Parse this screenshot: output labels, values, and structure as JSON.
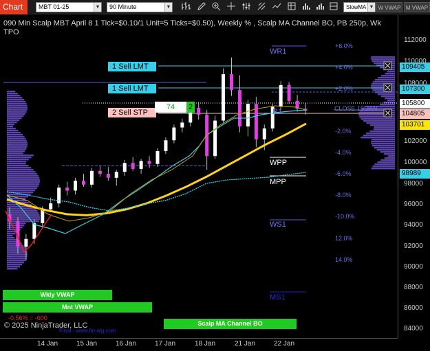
{
  "toolbar": {
    "tab_label": "Chart",
    "instrument": "MBT 01-25",
    "interval": "90 Minute",
    "strategy_select": "SlowMA",
    "btn_wvwap": "W VWAP",
    "btn_mvwap": "M VWAP"
  },
  "chart": {
    "title_line1": "090 Min Scalp MBT April 8 1 Tick=$0.10/1 Unit=5 Ticks=$0.50), Weekly % , Scalp MA Channel BO, PB 250p, Wk",
    "title_line2": "TPO",
    "levels": {
      "wr1": "WR1",
      "wpp": "WPP",
      "mpp": "MPP",
      "ws1": "WS1",
      "ms1": "MS1",
      "r1_mid": "R1",
      "close_label": "CLOSE 19 JAN"
    },
    "orders": [
      {
        "label": "1 Sell LMT"
      },
      {
        "label": "1 Sell LMT"
      },
      {
        "label": "2 Sell STP"
      }
    ],
    "stop_qty_value": "74",
    "stop_qty_marker": "2",
    "percent_labels": [
      "+6.0%",
      "+4.0%",
      "+2.0%",
      "-2.0%",
      "-4.0%",
      "-6.0%",
      "-8.0%",
      "-10.0%",
      "12.0%",
      "14.0%"
    ],
    "buttons": {
      "weekly_vwap": "Wkly VWAP",
      "monthly_vwap": "Mnt VWAP",
      "scalp_ma": "Scalp MA Channel BO"
    },
    "pnl_text": "-0.56% = -600",
    "copyright": "© 2025 NinjaTrader, LLC",
    "watermark": "Final - www.fin-alg.com"
  },
  "price_axis": {
    "labels": [
      "112000",
      "110000",
      "108000",
      "106000",
      "104000",
      "102000",
      "100000",
      "98000",
      "96000",
      "94000",
      "92000",
      "90000",
      "88000",
      "86000",
      "84000"
    ],
    "boxes": [
      {
        "value": "109405",
        "color": "#35d0e8"
      },
      {
        "value": "107300",
        "color": "#35d0e8"
      },
      {
        "value": "105800",
        "color": "#ffffff"
      },
      {
        "value": "104805",
        "color": "#ffc0c0"
      },
      {
        "value": "103701",
        "color": "#ffe600"
      },
      {
        "value": "98989",
        "color": "#35d0e8"
      }
    ]
  },
  "time_axis": {
    "labels": [
      "14 Jan",
      "15 Jan",
      "16 Jan",
      "17 Jan",
      "18 Jan",
      "21 Jan",
      "22 Jan"
    ]
  },
  "colors": {
    "tab_red": "#e23b1f",
    "cyan": "#35d0e8",
    "yellow_ma": "#ffd21a",
    "pivot_blue": "#5a5ae6",
    "green_btn": "#22c922"
  },
  "chart_data": {
    "type": "candlestick",
    "ylim": [
      83000,
      114000
    ],
    "x_labels": [
      "14 Jan",
      "15 Jan",
      "16 Jan",
      "17 Jan",
      "18 Jan",
      "21 Jan",
      "22 Jan"
    ],
    "candles": [
      [
        94500,
        95200,
        93000,
        93800
      ],
      [
        93800,
        94200,
        90500,
        91200
      ],
      [
        91200,
        92500,
        89800,
        92000
      ],
      [
        92000,
        94000,
        91500,
        93600
      ],
      [
        93600,
        95300,
        93100,
        95000
      ],
      [
        95000,
        96200,
        94700,
        95600
      ],
      [
        95600,
        97500,
        95200,
        97200
      ],
      [
        97200,
        97800,
        96400,
        96900
      ],
      [
        96900,
        98200,
        96500,
        97900
      ],
      [
        97900,
        98600,
        97300,
        97500
      ],
      [
        97500,
        99200,
        97200,
        98900
      ],
      [
        98900,
        99400,
        98300,
        98600
      ],
      [
        98600,
        99300,
        97900,
        98200
      ],
      [
        98200,
        99000,
        97400,
        98800
      ],
      [
        98800,
        100000,
        98400,
        99700
      ],
      [
        99700,
        100300,
        98900,
        99100
      ],
      [
        99100,
        100100,
        98600,
        99900
      ],
      [
        99900,
        100400,
        99200,
        99600
      ],
      [
        99600,
        101200,
        99300,
        100900
      ],
      [
        100900,
        102300,
        100600,
        102000
      ],
      [
        102000,
        103600,
        101700,
        103300
      ],
      [
        103300,
        104200,
        102800,
        103800
      ],
      [
        103800,
        105600,
        103400,
        105300
      ],
      [
        105300,
        105900,
        104100,
        104600
      ],
      [
        104600,
        105100,
        99000,
        100400
      ],
      [
        100400,
        104500,
        100100,
        104000
      ],
      [
        104000,
        109300,
        103800,
        108700
      ],
      [
        108700,
        110400,
        106500,
        107100
      ],
      [
        107100,
        108600,
        102800,
        103400
      ],
      [
        103400,
        106100,
        102400,
        105700
      ],
      [
        105700,
        106400,
        101300,
        102100
      ],
      [
        102100,
        103600,
        101000,
        103200
      ],
      [
        103200,
        105700,
        102900,
        105400
      ],
      [
        105400,
        108000,
        105100,
        107600
      ],
      [
        107600,
        107900,
        105700,
        106000
      ],
      [
        106000,
        106600,
        104900,
        105200
      ],
      [
        105200,
        105800,
        104600,
        105000
      ]
    ],
    "series": [
      {
        "name": "SlowMA",
        "values": [
          96000,
          95400,
          94900,
          94500,
          94400,
          94600,
          95000,
          95600,
          96400,
          97300,
          98300,
          99400,
          100500,
          101600,
          102600,
          103700
        ]
      }
    ]
  }
}
